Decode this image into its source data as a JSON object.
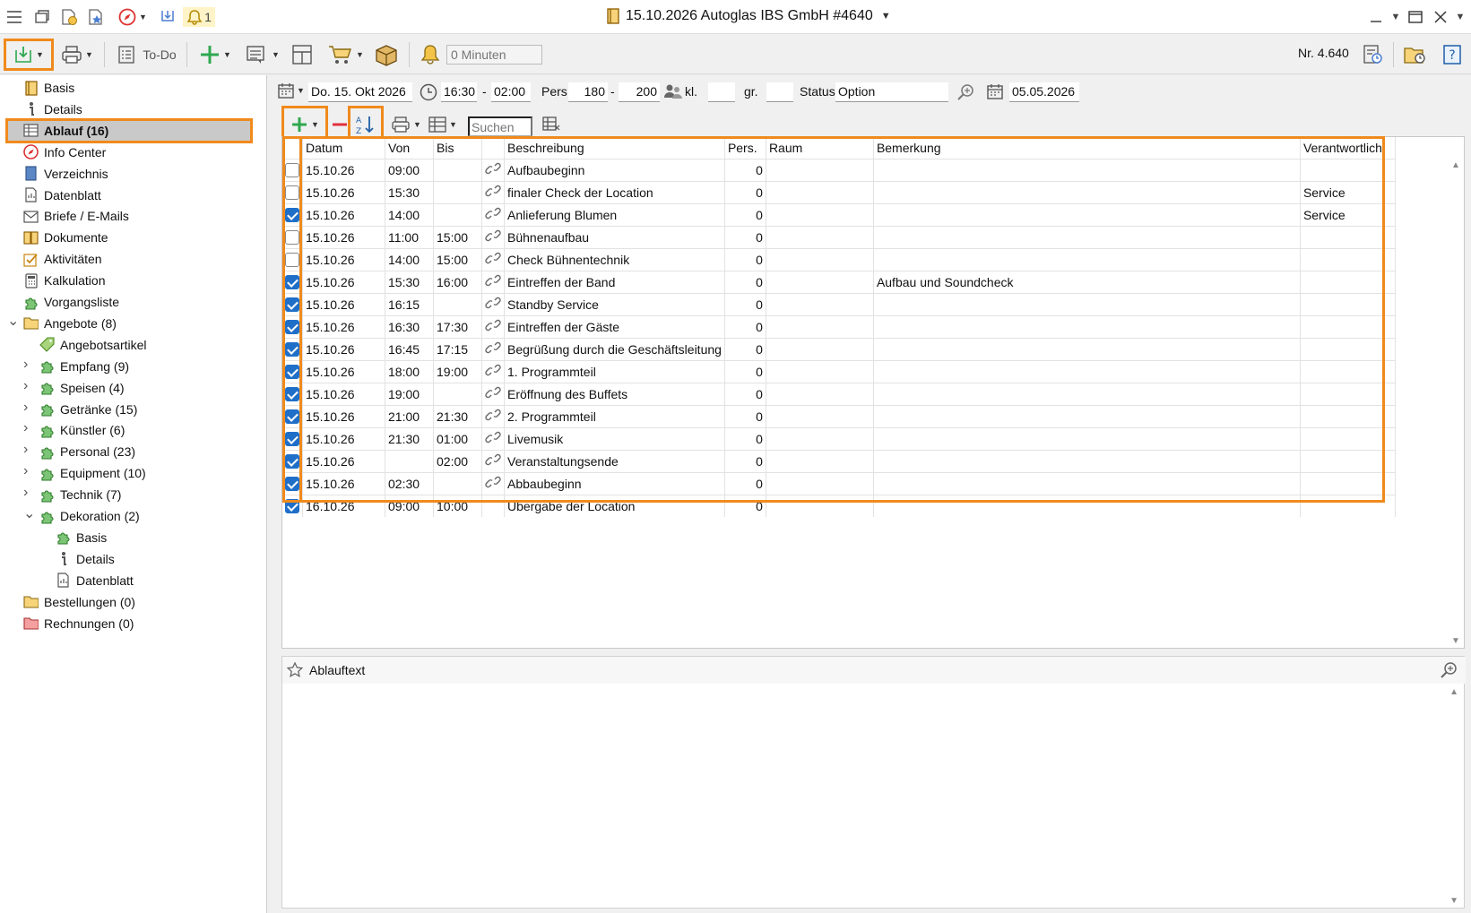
{
  "window": {
    "title": "15.10.2026 Autoglas IBS GmbH  #4640",
    "notification_count": "1"
  },
  "toolbar": {
    "todo_label": "To-Do",
    "minutes_placeholder": "0 Minuten",
    "number_label": "Nr. 4.640"
  },
  "sidebar": {
    "items": [
      {
        "label": "Basis",
        "icon": "document-icon"
      },
      {
        "label": "Details",
        "icon": "info-icon"
      },
      {
        "label": "Ablauf (16)",
        "icon": "table-icon"
      },
      {
        "label": "Info Center",
        "icon": "compass-icon"
      },
      {
        "label": "Verzeichnis",
        "icon": "book-icon"
      },
      {
        "label": "Datenblatt",
        "icon": "datasheet-icon"
      },
      {
        "label": "Briefe / E-Mails",
        "icon": "mail-icon"
      },
      {
        "label": "Dokumente",
        "icon": "documents-icon"
      },
      {
        "label": "Aktivitäten",
        "icon": "checklist-icon"
      },
      {
        "label": "Kalkulation",
        "icon": "calculator-icon"
      },
      {
        "label": "Vorgangsliste",
        "icon": "puzzle-icon"
      },
      {
        "label": "Angebote (8)",
        "icon": "folder-icon"
      },
      {
        "label": "Angebotsartikel",
        "icon": "tag-icon"
      },
      {
        "label": "Empfang (9)",
        "icon": "puzzle-icon"
      },
      {
        "label": "Speisen (4)",
        "icon": "puzzle-icon"
      },
      {
        "label": "Getränke (15)",
        "icon": "puzzle-icon"
      },
      {
        "label": "Künstler (6)",
        "icon": "puzzle-icon"
      },
      {
        "label": "Personal (23)",
        "icon": "puzzle-icon"
      },
      {
        "label": "Equipment (10)",
        "icon": "puzzle-icon"
      },
      {
        "label": "Technik (7)",
        "icon": "puzzle-icon"
      },
      {
        "label": "Dekoration (2)",
        "icon": "puzzle-icon"
      },
      {
        "label": "Basis",
        "icon": "puzzle-icon"
      },
      {
        "label": "Details",
        "icon": "info-icon"
      },
      {
        "label": "Datenblatt",
        "icon": "datasheet-icon"
      },
      {
        "label": "Bestellungen (0)",
        "icon": "folder-icon"
      },
      {
        "label": "Rechnungen (0)",
        "icon": "folder-red-icon"
      }
    ]
  },
  "event": {
    "date": "Do. 15. Okt 2026",
    "time_from": "16:30",
    "time_sep": "-",
    "time_to": "02:00",
    "pers_label": "Pers.",
    "pers_min": "180",
    "pers_sep": "-",
    "pers_max": "200",
    "kl_label": "kl.",
    "kl_value": "",
    "gr_label": "gr.",
    "gr_value": "",
    "status_label": "Status",
    "status_value": "Option",
    "option_date": "05.05.2026"
  },
  "schedule": {
    "search_placeholder": "Suchen",
    "columns": [
      "Datum",
      "Von",
      "Bis",
      "",
      "Beschreibung",
      "Pers.",
      "Raum",
      "Bemerkung",
      "Verantwortlich"
    ],
    "rows": [
      {
        "checked": false,
        "datum": "15.10.26",
        "von": "09:00",
        "bis": "",
        "link": true,
        "beschreibung": "Aufbaubeginn",
        "pers": "0",
        "raum": "",
        "bemerkung": "",
        "verantwortlich": ""
      },
      {
        "checked": false,
        "datum": "15.10.26",
        "von": "15:30",
        "bis": "",
        "link": true,
        "beschreibung": "finaler Check der Location",
        "pers": "0",
        "raum": "",
        "bemerkung": "",
        "verantwortlich": "Service"
      },
      {
        "checked": true,
        "datum": "15.10.26",
        "von": "14:00",
        "bis": "",
        "link": true,
        "beschreibung": "Anlieferung Blumen",
        "pers": "0",
        "raum": "",
        "bemerkung": "",
        "verantwortlich": "Service"
      },
      {
        "checked": false,
        "datum": "15.10.26",
        "von": "11:00",
        "bis": "15:00",
        "link": true,
        "beschreibung": "Bühnenaufbau",
        "pers": "0",
        "raum": "",
        "bemerkung": "",
        "verantwortlich": ""
      },
      {
        "checked": false,
        "datum": "15.10.26",
        "von": "14:00",
        "bis": "15:00",
        "link": true,
        "beschreibung": "Check Bühnentechnik",
        "pers": "0",
        "raum": "",
        "bemerkung": "",
        "verantwortlich": ""
      },
      {
        "checked": true,
        "datum": "15.10.26",
        "von": "15:30",
        "bis": "16:00",
        "link": true,
        "beschreibung": "Eintreffen der Band",
        "pers": "0",
        "raum": "",
        "bemerkung": "Aufbau und Soundcheck",
        "verantwortlich": ""
      },
      {
        "checked": true,
        "datum": "15.10.26",
        "von": "16:15",
        "bis": "",
        "link": true,
        "beschreibung": "Standby Service",
        "pers": "0",
        "raum": "",
        "bemerkung": "",
        "verantwortlich": ""
      },
      {
        "checked": true,
        "datum": "15.10.26",
        "von": "16:30",
        "bis": "17:30",
        "link": true,
        "beschreibung": "Eintreffen der Gäste",
        "pers": "0",
        "raum": "",
        "bemerkung": "",
        "verantwortlich": ""
      },
      {
        "checked": true,
        "datum": "15.10.26",
        "von": "16:45",
        "bis": "17:15",
        "link": true,
        "beschreibung": "Begrüßung durch die Geschäftsleitung",
        "pers": "0",
        "raum": "",
        "bemerkung": "",
        "verantwortlich": ""
      },
      {
        "checked": true,
        "datum": "15.10.26",
        "von": "18:00",
        "bis": "19:00",
        "link": true,
        "beschreibung": "1. Programmteil",
        "pers": "0",
        "raum": "",
        "bemerkung": "",
        "verantwortlich": ""
      },
      {
        "checked": true,
        "datum": "15.10.26",
        "von": "19:00",
        "bis": "",
        "link": true,
        "beschreibung": "Eröffnung des Buffets",
        "pers": "0",
        "raum": "",
        "bemerkung": "",
        "verantwortlich": ""
      },
      {
        "checked": true,
        "datum": "15.10.26",
        "von": "21:00",
        "bis": "21:30",
        "link": true,
        "beschreibung": "2. Programmteil",
        "pers": "0",
        "raum": "",
        "bemerkung": "",
        "verantwortlich": ""
      },
      {
        "checked": true,
        "datum": "15.10.26",
        "von": "21:30",
        "bis": "01:00",
        "link": true,
        "beschreibung": "Livemusik",
        "pers": "0",
        "raum": "",
        "bemerkung": "",
        "verantwortlich": ""
      },
      {
        "checked": true,
        "datum": "15.10.26",
        "von": "",
        "bis": "02:00",
        "link": true,
        "beschreibung": "Veranstaltungsende",
        "pers": "0",
        "raum": "",
        "bemerkung": "",
        "verantwortlich": ""
      },
      {
        "checked": true,
        "datum": "15.10.26",
        "von": "02:30",
        "bis": "",
        "link": true,
        "beschreibung": "Abbaubeginn",
        "pers": "0",
        "raum": "",
        "bemerkung": "",
        "verantwortlich": ""
      },
      {
        "checked": true,
        "datum": "16.10.26",
        "von": "09:00",
        "bis": "10:00",
        "link": false,
        "beschreibung": "Übergabe der Location",
        "pers": "0",
        "raum": "",
        "bemerkung": "",
        "verantwortlich": ""
      }
    ]
  },
  "text_panel": {
    "title": "Ablauftext"
  },
  "colors": {
    "highlight": "#f08a1c",
    "checkbox_on": "#1f6fc9",
    "accent_green": "#2fa84f",
    "remove_red": "#e0313f"
  }
}
